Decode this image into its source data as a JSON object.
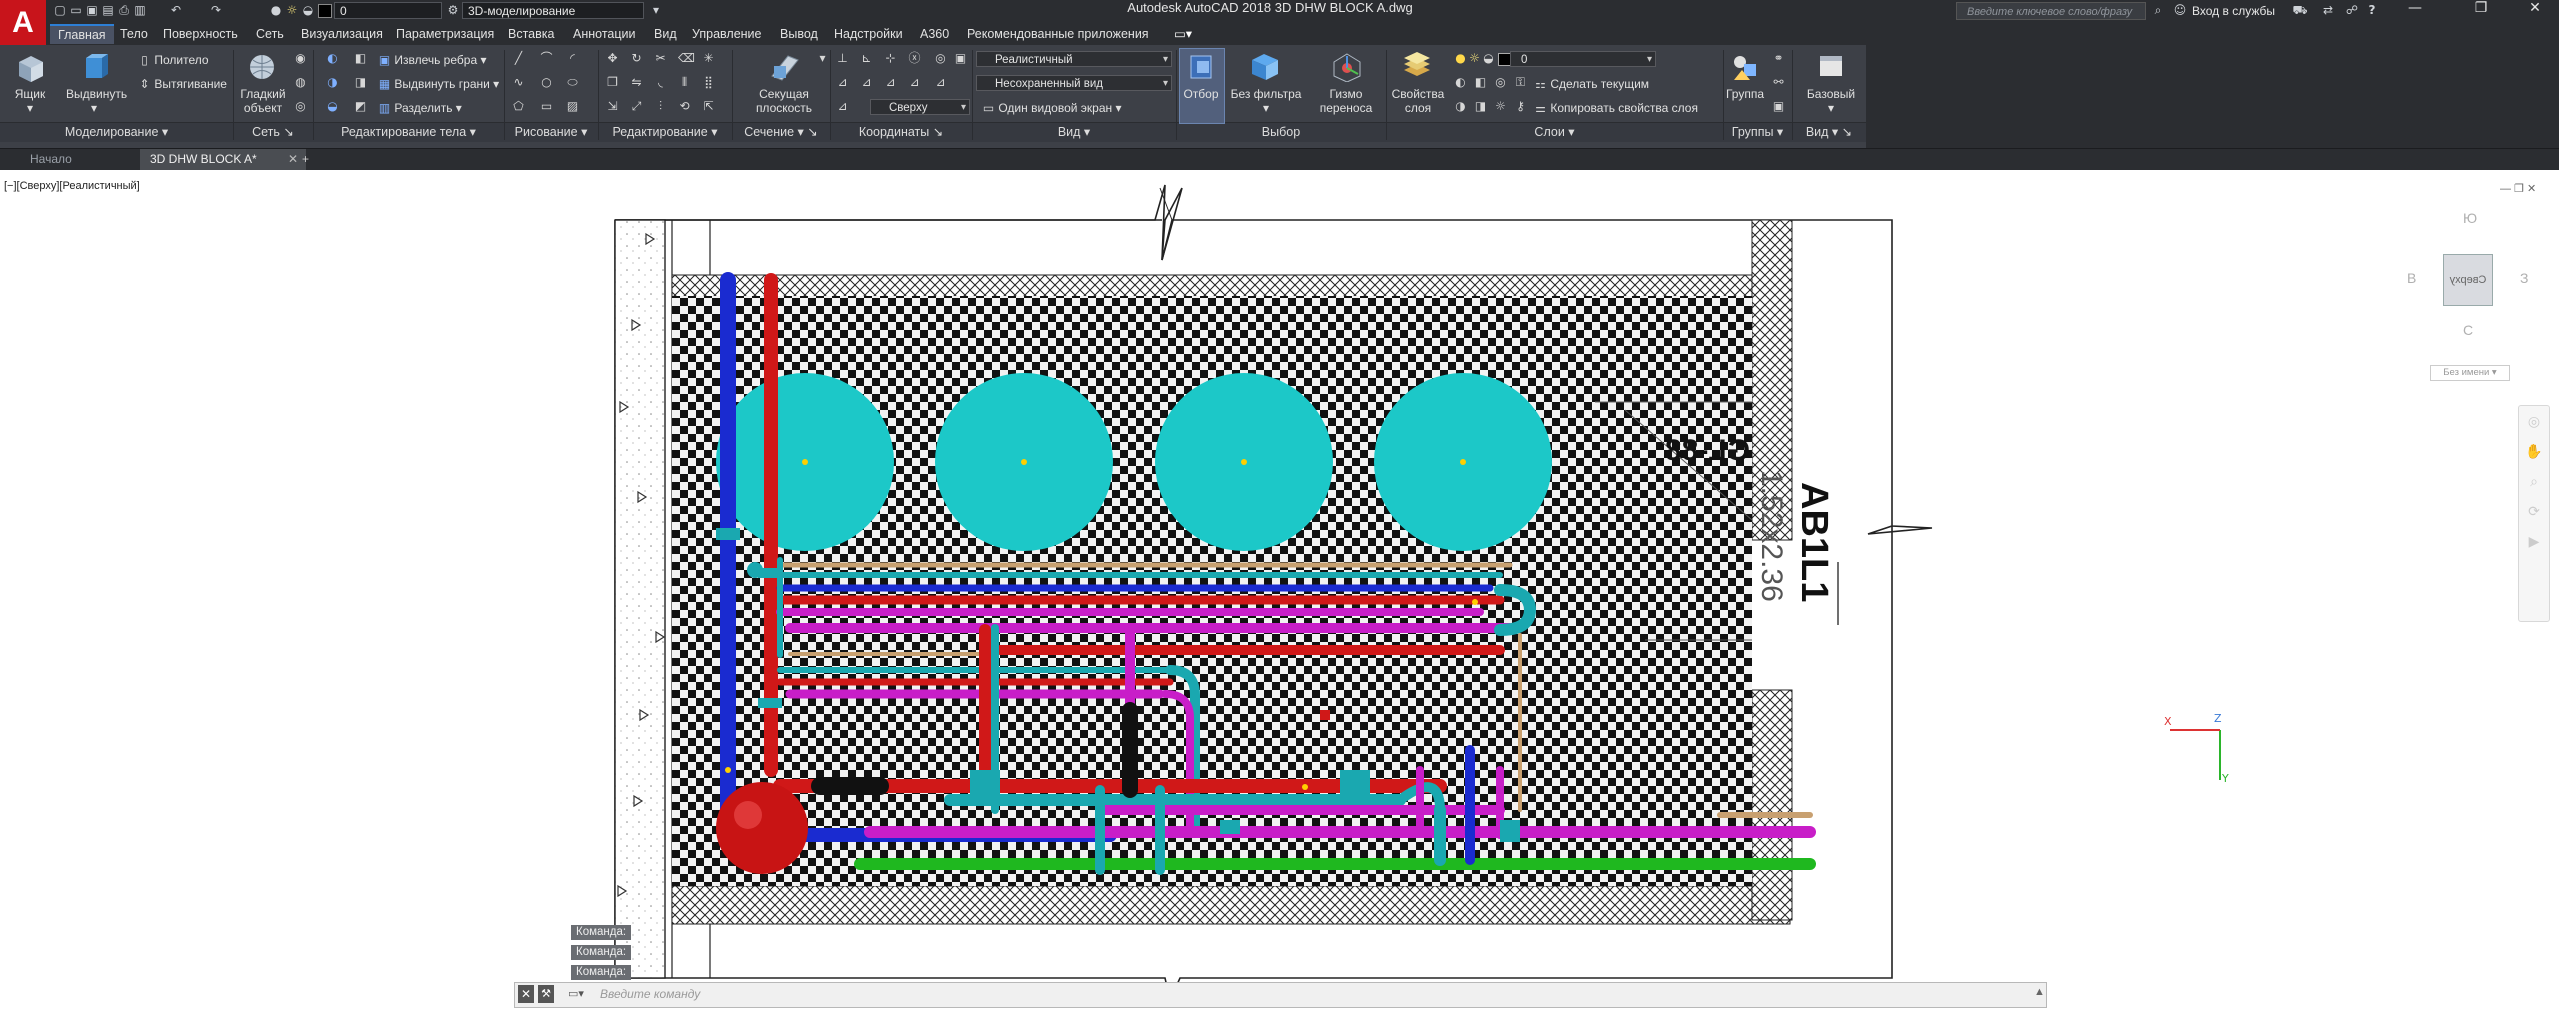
{
  "app": {
    "logo_letter": "A",
    "window_title": "Autodesk AutoCAD 2018    3D DHW BLOCK A.dwg",
    "layer_combo": "0",
    "workspace_combo": "3D-моделирование",
    "search_placeholder": "Введите ключевое слово/фразу",
    "signin": "Вход в службы",
    "help": "?"
  },
  "ribbon_tabs": [
    "Главная",
    "Тело",
    "Поверхность",
    "Сеть",
    "Визуализация",
    "Параметризация",
    "Вставка",
    "Аннотации",
    "Вид",
    "Управление",
    "Вывод",
    "Надстройки",
    "A360",
    "Рекомендованные приложения"
  ],
  "ribbon": {
    "box_label": "Ящик",
    "extrude_label": "Выдвинуть",
    "polysolid_label": "Политело",
    "press_pull_label": "Вытягивание",
    "smooth_label1": "Гладкий",
    "smooth_label2": "объект",
    "extract_edges": "Извлечь ребра",
    "extrude_faces": "Выдвинуть грани",
    "separate": "Разделить",
    "section_label1": "Секущая",
    "section_label2": "плоскость",
    "view_combo_top": "Сверху",
    "visual_style": "Реалистичный",
    "unsaved_view": "Несохраненный вид",
    "single_viewport": "Один видовой экран",
    "culling_label": "Отбор",
    "no_filter1": "Без фильтра",
    "gizmo1": "Гизмо",
    "gizmo2": "переноса",
    "layer_props1": "Свойства",
    "layer_props2": "слоя",
    "layer_combo": "0",
    "make_current": "Сделать текущим",
    "match_layer": "Копировать свойства слоя",
    "group_label": "Группа",
    "base_label": "Базовый"
  },
  "panel_labels": [
    "Моделирование",
    "Сеть",
    "Редактирование тела",
    "Рисование",
    "Редактирование",
    "Сечение",
    "Координаты",
    "Вид",
    "Выбор",
    "Слои",
    "Группы",
    "Вид"
  ],
  "doc_tabs": {
    "start": "Начало",
    "active": "3D DHW BLOCK A*",
    "add": "+"
  },
  "viewport": {
    "label": "[−][Сверху][Реалистичный]",
    "block_name": "AB1L1",
    "dimension_text": "1.52x2.36",
    "mirrored_text": "GL-88",
    "wcs_label": "Без имени"
  },
  "viewcube": {
    "face": "Сверху",
    "north": "Ю",
    "south": "С",
    "east": "З",
    "west": "В"
  },
  "command": {
    "history": [
      "Команда:",
      "Команда:",
      "Команда:"
    ],
    "placeholder": "Введите команду"
  },
  "colors": {
    "tank": "#1cc8c8",
    "hot_pipe": "#d01818",
    "cold_pipe": "#1a2bd0",
    "recirc_pipe": "#c81ec8",
    "fitting": "#1aa8b0",
    "gas_pipe": "#1fb81f",
    "ribbon_bg": "#3d4047"
  }
}
